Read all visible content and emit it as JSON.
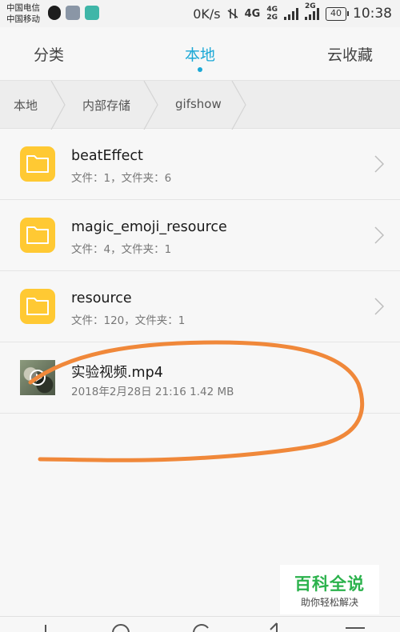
{
  "status_bar": {
    "carrier_1": "中国电信",
    "carrier_2": "中国移动",
    "speed": "0K/s",
    "network_main": "4G",
    "network_a": "4G",
    "network_b": "2G",
    "network_c": "2G",
    "battery": "40",
    "time": "10:38"
  },
  "tabs": [
    {
      "label": "分类"
    },
    {
      "label": "本地"
    },
    {
      "label": "云收藏"
    }
  ],
  "active_tab": "本地",
  "breadcrumb": [
    "本地",
    "内部存储",
    "gifshow"
  ],
  "items": [
    {
      "name": "beatEffect",
      "meta": "文件：1，文件夹：6",
      "type": "folder"
    },
    {
      "name": "magic_emoji_resource",
      "meta": "文件：4，文件夹：1",
      "type": "folder"
    },
    {
      "name": "resource",
      "meta": "文件：120，文件夹：1",
      "type": "folder"
    },
    {
      "name": "实验视频.mp4",
      "meta": "2018年2月28日 21:16 1.42 MB",
      "type": "video"
    }
  ],
  "watermark": {
    "title": "百科全说",
    "subtitle": "助你轻松解决"
  },
  "colors": {
    "accent": "#1ba8d6",
    "folder": "#ffc933",
    "annotation": "#f0883a",
    "watermark": "#2bb24c"
  }
}
